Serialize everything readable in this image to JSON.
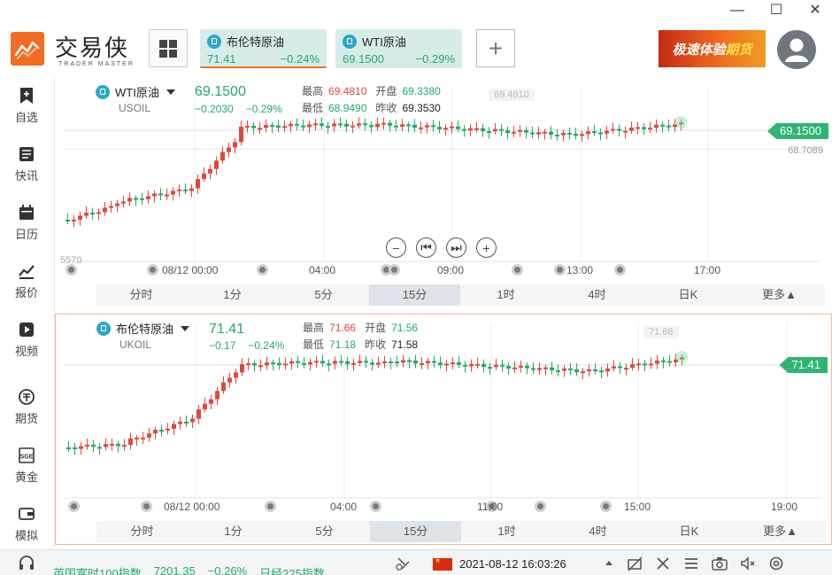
{
  "window": {
    "minimize": "—",
    "maximize": "☐",
    "close": "✕"
  },
  "header": {
    "brand_cn": "交易侠",
    "brand_en": "TRADER MASTER",
    "tabs": [
      {
        "name": "布伦特原油",
        "price": "71.41",
        "change": "−0.24%"
      },
      {
        "name": "WTI原油",
        "price": "69.1500",
        "change": "−0.29%"
      }
    ],
    "add_label": "+",
    "promo_a": "极速体验",
    "promo_b": "期货"
  },
  "sidebar": {
    "items": [
      "自选",
      "快讯",
      "日历",
      "报价",
      "视频",
      "期货",
      "黄金",
      "模拟"
    ]
  },
  "panel1": {
    "name": "WTI原油",
    "code": "USOIL",
    "last": "69.1500",
    "chg": "−0.2030",
    "pct": "−0.29%",
    "high_label": "最高",
    "high": "69.4810",
    "open_label": "开盘",
    "open": "69.3380",
    "low_label": "最低",
    "low": "68.9490",
    "prev_label": "昨收",
    "prev": "69.3530",
    "max_tag": "69.4810",
    "price_tag": "69.1500",
    "ref_price": "68.7089",
    "min_tag": "5570",
    "axis": [
      "08/12 00:00",
      "04:00",
      "09:00",
      "13:00",
      "17:00"
    ]
  },
  "panel2": {
    "name": "布伦特原油",
    "code": "UKOIL",
    "last": "71.41",
    "chg": "−0.17",
    "pct": "−0.24%",
    "high_label": "最高",
    "high": "71.66",
    "open_label": "开盘",
    "open": "71.56",
    "low_label": "最低",
    "low": "71.18",
    "prev_label": "昨收",
    "prev": "71.58",
    "max_tag": "71.66",
    "price_tag": "71.41",
    "axis": [
      "08/12 00:00",
      "04:00",
      "11:00",
      "15:00",
      "19:00"
    ]
  },
  "timeframes": [
    "分时",
    "1分",
    "5分",
    "15分",
    "1时",
    "4时",
    "日K",
    "更多▲"
  ],
  "active_timeframe": "15分",
  "status": {
    "ticker_name": "英国富时100指数",
    "ticker_value": "7201.35",
    "ticker_pct": "−0.26%",
    "ticker2": "日经225指数",
    "datetime": "2021-08-12 16:03:26"
  },
  "colors": {
    "up": "#e0483d",
    "down": "#22a86b",
    "accent": "#f26d21"
  }
}
